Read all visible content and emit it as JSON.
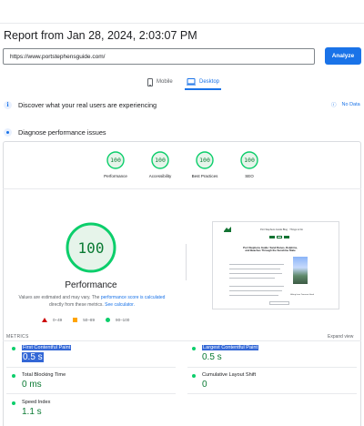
{
  "report": {
    "title": "Report from Jan 28, 2024, 2:03:07 PM"
  },
  "search": {
    "url": "https://www.portstephensguide.com/",
    "analyze_label": "Analyze"
  },
  "device_tabs": {
    "mobile": "Mobile",
    "desktop": "Desktop",
    "selected": "desktop"
  },
  "sections": {
    "discover": "Discover what your real users are experiencing",
    "no_data": "No Data",
    "diagnose": "Diagnose performance issues"
  },
  "categories": [
    {
      "label": "Performance",
      "score": "100"
    },
    {
      "label": "Accessibility",
      "score": "100"
    },
    {
      "label": "Best Practices",
      "score": "100"
    },
    {
      "label": "SEO",
      "score": "100"
    }
  ],
  "performance": {
    "score": "100",
    "label": "Performance",
    "note_prefix": "Values are estimated and may vary. The ",
    "note_link": "performance score is calculated",
    "note_mid": " directly from these metrics. ",
    "note_calc": "See calculator."
  },
  "legend": {
    "fail": "0–49",
    "average": "50–89",
    "pass": "90–100"
  },
  "screenshot": {
    "site_title": "Port Stephens Guide Blog · Things to Do",
    "article_title": "Port Stephens Guide: Sand Dunes, Dolphins, and Beaches Through the Sunshine State",
    "caption": "Hiking from Tomaree Head"
  },
  "metrics": {
    "label": "METRICS",
    "expand": "Expand view",
    "items": {
      "fcp": {
        "name": "First Contentful Paint",
        "value": "0.5 s"
      },
      "lcp": {
        "name": "Largest Contentful Paint",
        "value": "0.5 s"
      },
      "tbt": {
        "name": "Total Blocking Time",
        "value": "0 ms"
      },
      "cls": {
        "name": "Cumulative Layout Shift",
        "value": "0"
      },
      "si": {
        "name": "Speed Index",
        "value": "1.1 s"
      }
    }
  },
  "colors": {
    "accent": "#1a73e8",
    "pass": "#0cce6b",
    "pass_text": "#0a7a33",
    "average": "#ffa400",
    "fail": "#cc0000",
    "highlight": "#3367d6"
  }
}
